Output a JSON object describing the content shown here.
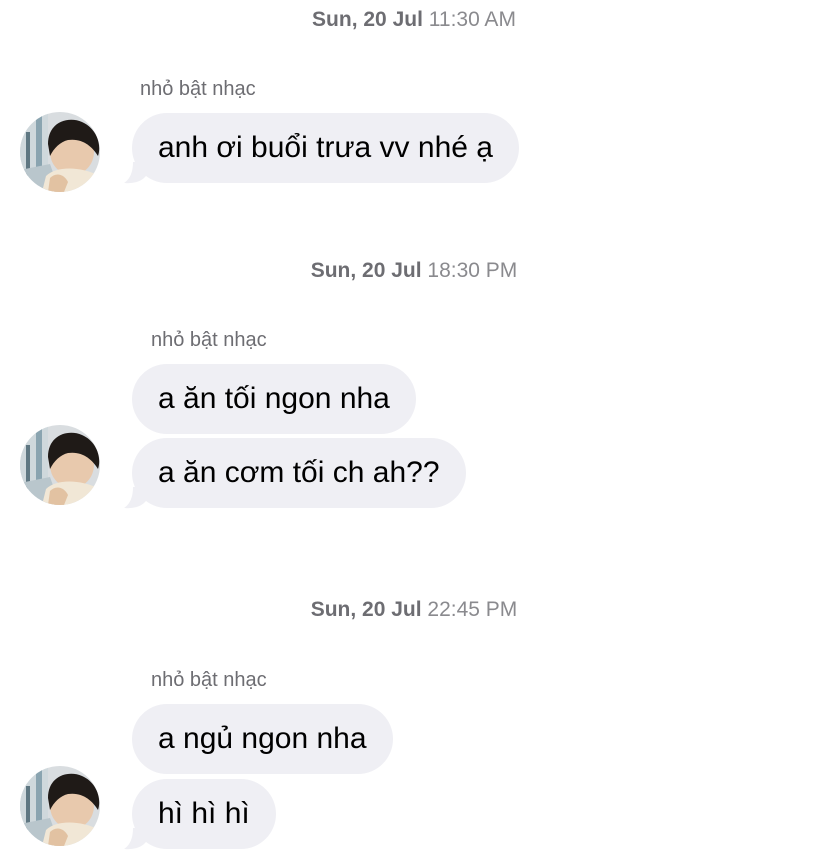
{
  "thread": {
    "groups": [
      {
        "timestamp": {
          "day": "Sun, 20 Jul",
          "time": "11:30 AM"
        },
        "sender": "nhỏ bật nhạc",
        "messages": [
          "anh ơi buổi trưa vv nhé ạ"
        ]
      },
      {
        "timestamp": {
          "day": "Sun, 20 Jul",
          "time": "18:30 PM"
        },
        "sender": "nhỏ bật nhạc",
        "messages": [
          "a ăn tối ngon nha",
          "a ăn cơm tối ch ah??"
        ]
      },
      {
        "timestamp": {
          "day": "Sun, 20 Jul",
          "time": "22:45 PM"
        },
        "sender": "nhỏ bật nhạc",
        "messages": [
          "a ngủ ngon nha",
          "hì hì hì"
        ]
      }
    ]
  },
  "colors": {
    "bubble_background": "#efeff4",
    "secondary_text": "#6d6d72",
    "message_text": "#000000"
  },
  "icons": {
    "avatar": "profile-photo"
  }
}
